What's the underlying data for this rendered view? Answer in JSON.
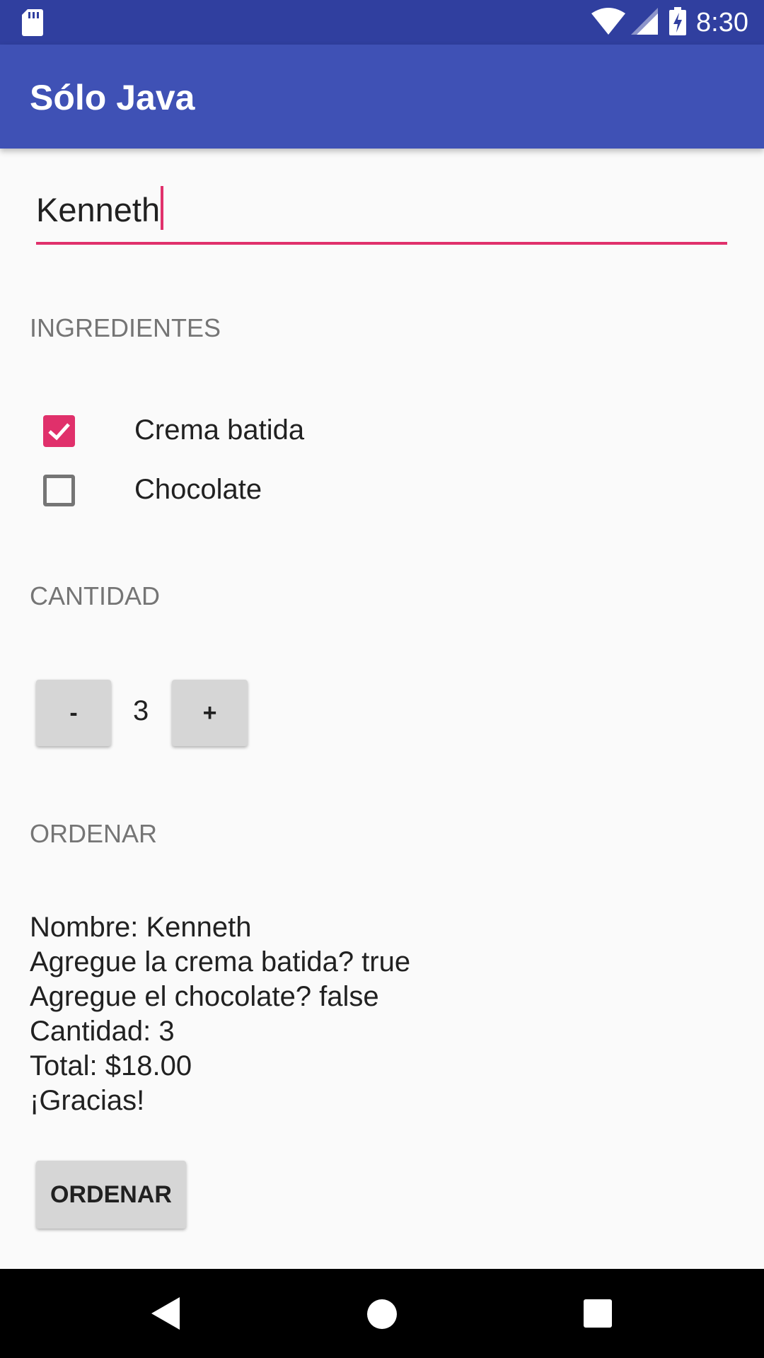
{
  "status_bar": {
    "time": "8:30",
    "icons": [
      "sd-card-icon",
      "wifi-icon",
      "cell-signal-icon",
      "battery-charging-icon"
    ]
  },
  "app_bar": {
    "title": "Sólo Java"
  },
  "name_input": {
    "value": "Kenneth"
  },
  "sections": {
    "ingredients": "INGREDIENTES",
    "quantity": "CANTIDAD",
    "order": "ORDENAR"
  },
  "toppings": [
    {
      "label": "Crema batida",
      "checked": true
    },
    {
      "label": "Chocolate",
      "checked": false
    }
  ],
  "quantity": {
    "decrement_label": "-",
    "value": "3",
    "increment_label": "+"
  },
  "summary": {
    "lines": [
      "Nombre: Kenneth",
      "Agregue la crema batida? true",
      "Agregue el chocolate? false",
      "Cantidad: 3",
      "Total: $18.00",
      "¡Gracias!"
    ]
  },
  "order_button": {
    "label": "ORDENAR"
  },
  "colors": {
    "status_bar": "#303f9f",
    "app_bar": "#3f51b5",
    "accent": "#e0306b",
    "background": "#fafafa",
    "button": "#d6d6d6"
  }
}
